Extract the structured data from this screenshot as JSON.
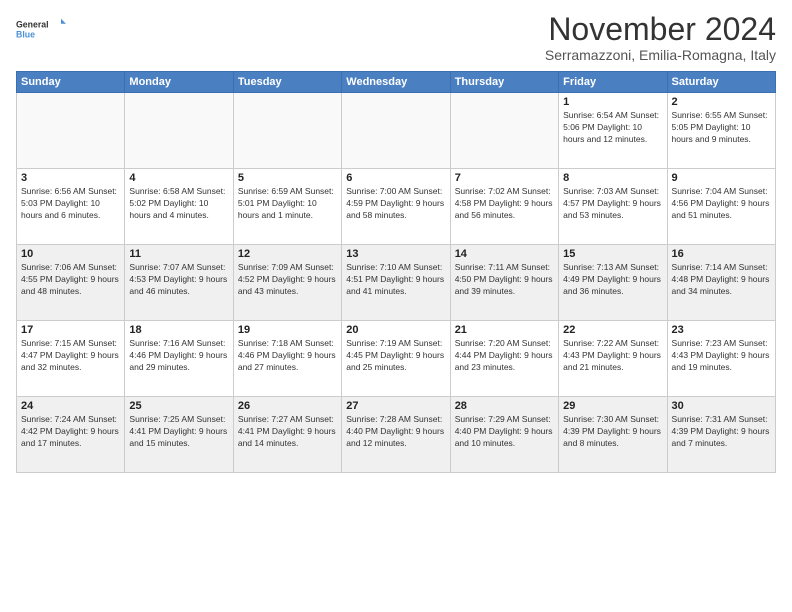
{
  "logo": {
    "line1": "General",
    "line2": "Blue"
  },
  "title": "November 2024",
  "subtitle": "Serramazzoni, Emilia-Romagna, Italy",
  "days_header": [
    "Sunday",
    "Monday",
    "Tuesday",
    "Wednesday",
    "Thursday",
    "Friday",
    "Saturday"
  ],
  "weeks": [
    [
      {
        "num": "",
        "info": ""
      },
      {
        "num": "",
        "info": ""
      },
      {
        "num": "",
        "info": ""
      },
      {
        "num": "",
        "info": ""
      },
      {
        "num": "",
        "info": ""
      },
      {
        "num": "1",
        "info": "Sunrise: 6:54 AM\nSunset: 5:06 PM\nDaylight: 10 hours and 12 minutes."
      },
      {
        "num": "2",
        "info": "Sunrise: 6:55 AM\nSunset: 5:05 PM\nDaylight: 10 hours and 9 minutes."
      }
    ],
    [
      {
        "num": "3",
        "info": "Sunrise: 6:56 AM\nSunset: 5:03 PM\nDaylight: 10 hours and 6 minutes."
      },
      {
        "num": "4",
        "info": "Sunrise: 6:58 AM\nSunset: 5:02 PM\nDaylight: 10 hours and 4 minutes."
      },
      {
        "num": "5",
        "info": "Sunrise: 6:59 AM\nSunset: 5:01 PM\nDaylight: 10 hours and 1 minute."
      },
      {
        "num": "6",
        "info": "Sunrise: 7:00 AM\nSunset: 4:59 PM\nDaylight: 9 hours and 58 minutes."
      },
      {
        "num": "7",
        "info": "Sunrise: 7:02 AM\nSunset: 4:58 PM\nDaylight: 9 hours and 56 minutes."
      },
      {
        "num": "8",
        "info": "Sunrise: 7:03 AM\nSunset: 4:57 PM\nDaylight: 9 hours and 53 minutes."
      },
      {
        "num": "9",
        "info": "Sunrise: 7:04 AM\nSunset: 4:56 PM\nDaylight: 9 hours and 51 minutes."
      }
    ],
    [
      {
        "num": "10",
        "info": "Sunrise: 7:06 AM\nSunset: 4:55 PM\nDaylight: 9 hours and 48 minutes."
      },
      {
        "num": "11",
        "info": "Sunrise: 7:07 AM\nSunset: 4:53 PM\nDaylight: 9 hours and 46 minutes."
      },
      {
        "num": "12",
        "info": "Sunrise: 7:09 AM\nSunset: 4:52 PM\nDaylight: 9 hours and 43 minutes."
      },
      {
        "num": "13",
        "info": "Sunrise: 7:10 AM\nSunset: 4:51 PM\nDaylight: 9 hours and 41 minutes."
      },
      {
        "num": "14",
        "info": "Sunrise: 7:11 AM\nSunset: 4:50 PM\nDaylight: 9 hours and 39 minutes."
      },
      {
        "num": "15",
        "info": "Sunrise: 7:13 AM\nSunset: 4:49 PM\nDaylight: 9 hours and 36 minutes."
      },
      {
        "num": "16",
        "info": "Sunrise: 7:14 AM\nSunset: 4:48 PM\nDaylight: 9 hours and 34 minutes."
      }
    ],
    [
      {
        "num": "17",
        "info": "Sunrise: 7:15 AM\nSunset: 4:47 PM\nDaylight: 9 hours and 32 minutes."
      },
      {
        "num": "18",
        "info": "Sunrise: 7:16 AM\nSunset: 4:46 PM\nDaylight: 9 hours and 29 minutes."
      },
      {
        "num": "19",
        "info": "Sunrise: 7:18 AM\nSunset: 4:46 PM\nDaylight: 9 hours and 27 minutes."
      },
      {
        "num": "20",
        "info": "Sunrise: 7:19 AM\nSunset: 4:45 PM\nDaylight: 9 hours and 25 minutes."
      },
      {
        "num": "21",
        "info": "Sunrise: 7:20 AM\nSunset: 4:44 PM\nDaylight: 9 hours and 23 minutes."
      },
      {
        "num": "22",
        "info": "Sunrise: 7:22 AM\nSunset: 4:43 PM\nDaylight: 9 hours and 21 minutes."
      },
      {
        "num": "23",
        "info": "Sunrise: 7:23 AM\nSunset: 4:43 PM\nDaylight: 9 hours and 19 minutes."
      }
    ],
    [
      {
        "num": "24",
        "info": "Sunrise: 7:24 AM\nSunset: 4:42 PM\nDaylight: 9 hours and 17 minutes."
      },
      {
        "num": "25",
        "info": "Sunrise: 7:25 AM\nSunset: 4:41 PM\nDaylight: 9 hours and 15 minutes."
      },
      {
        "num": "26",
        "info": "Sunrise: 7:27 AM\nSunset: 4:41 PM\nDaylight: 9 hours and 14 minutes."
      },
      {
        "num": "27",
        "info": "Sunrise: 7:28 AM\nSunset: 4:40 PM\nDaylight: 9 hours and 12 minutes."
      },
      {
        "num": "28",
        "info": "Sunrise: 7:29 AM\nSunset: 4:40 PM\nDaylight: 9 hours and 10 minutes."
      },
      {
        "num": "29",
        "info": "Sunrise: 7:30 AM\nSunset: 4:39 PM\nDaylight: 9 hours and 8 minutes."
      },
      {
        "num": "30",
        "info": "Sunrise: 7:31 AM\nSunset: 4:39 PM\nDaylight: 9 hours and 7 minutes."
      }
    ]
  ]
}
